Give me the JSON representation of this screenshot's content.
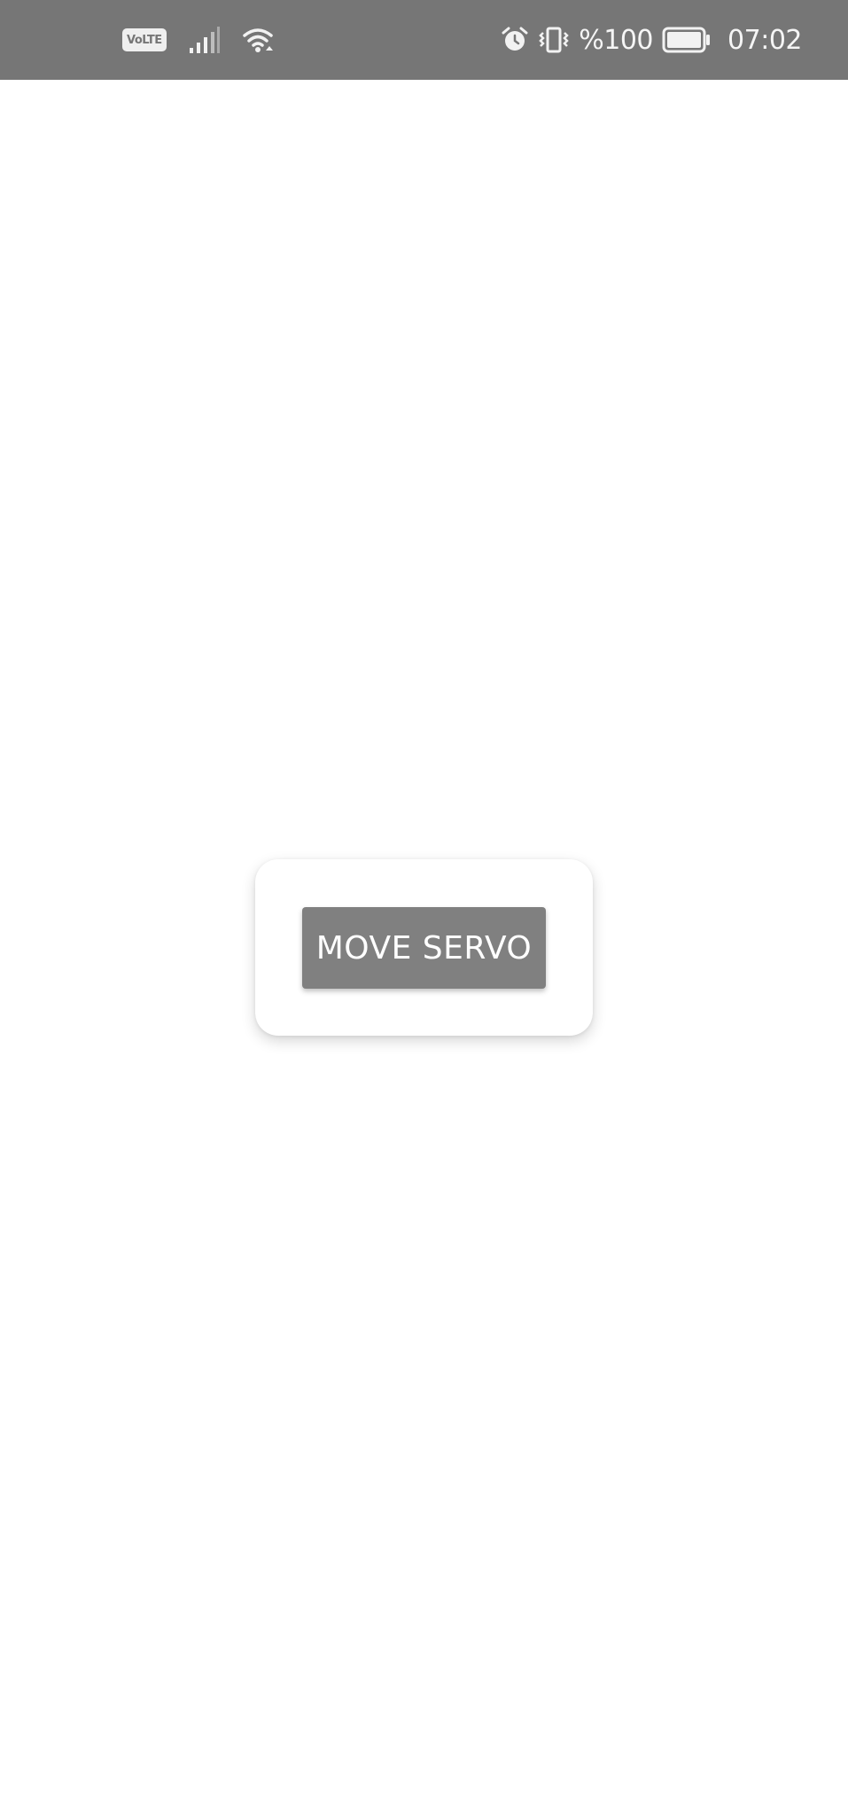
{
  "status_bar": {
    "volte_label": "VoLTE",
    "battery_percent": "%100",
    "time": "07:02",
    "icons": [
      "volte-icon",
      "signal-icon",
      "wifi-icon",
      "alarm-icon",
      "vibrate-icon",
      "battery-icon"
    ],
    "background_color": "#767676"
  },
  "main": {
    "button_label": "MOVE SERVO",
    "button_color": "#808080",
    "card_color": "#ffffff"
  }
}
